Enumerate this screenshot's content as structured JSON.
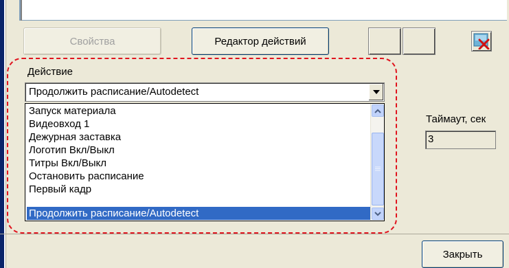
{
  "toolbar": {
    "properties_label": "Свойства",
    "action_editor_label": "Редактор действий"
  },
  "action_group": {
    "label": "Действие",
    "selected_value": "Продолжить расписание/Autodetect",
    "items": [
      "Запуск материала",
      "Видеовход 1",
      "Дежурная заставка",
      "Логотип Вкл/Выкл",
      "Титры Вкл/Выкл",
      "Остановить расписание",
      "Первый кадр",
      "Продолжить расписание/Autodetect"
    ],
    "selected_index": 7
  },
  "timeout": {
    "label": "Таймаут, сек",
    "value": "3"
  },
  "footer": {
    "close_label": "Закрыть"
  },
  "colors": {
    "selection": "#316ac5",
    "frame_dashed": "#e0141e",
    "delete_x": "#d01010"
  }
}
